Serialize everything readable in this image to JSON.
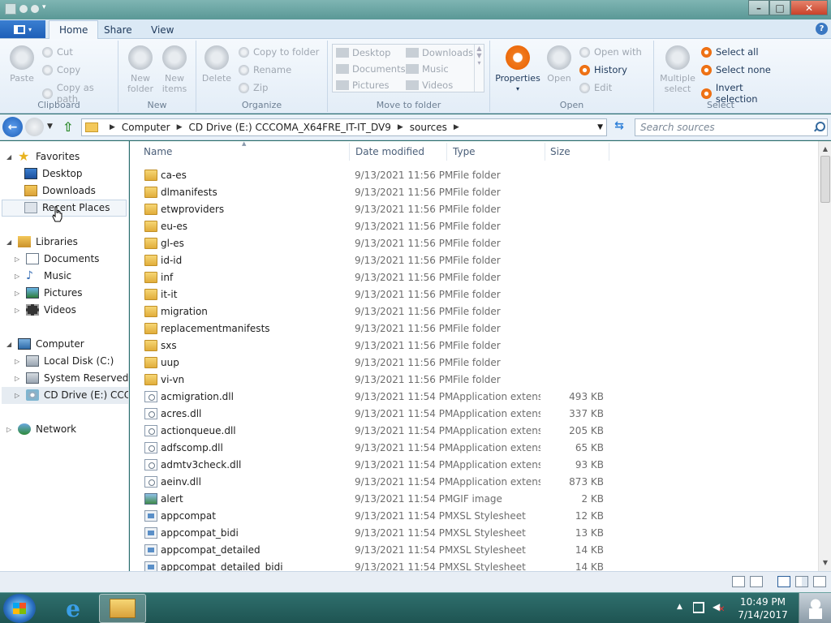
{
  "ribbon_tabs": [
    "Home",
    "Share",
    "View"
  ],
  "clipboard": {
    "paste": "Paste",
    "cut": "Cut",
    "copy": "Copy",
    "copy_as_path": "Copy as path",
    "group": "Clipboard"
  },
  "new_group": {
    "new_folder": "New folder",
    "new_items": "New items",
    "group": "New"
  },
  "organize": {
    "delete": "Delete",
    "copy_to_folder": "Copy to folder",
    "rename": "Rename",
    "zip": "Zip",
    "group": "Organize"
  },
  "move_to": {
    "items": [
      "Desktop",
      "Downloads",
      "Documents",
      "Music",
      "Pictures",
      "Videos"
    ],
    "group": "Move to folder"
  },
  "open_group": {
    "properties": "Properties",
    "open": "Open",
    "open_with": "Open with",
    "history": "History",
    "edit": "Edit",
    "group": "Open"
  },
  "select_group": {
    "multiple_select": "Multiple select",
    "select_all": "Select all",
    "select_none": "Select none",
    "invert_selection": "Invert selection",
    "group": "Select"
  },
  "breadcrumb": [
    "Computer",
    "CD Drive (E:) CCCOMA_X64FRE_IT-IT_DV9",
    "sources"
  ],
  "search": {
    "placeholder": "Search sources"
  },
  "nav": {
    "favorites": "Favorites",
    "desktop": "Desktop",
    "downloads": "Downloads",
    "recent_places": "Recent Places",
    "libraries": "Libraries",
    "documents": "Documents",
    "music": "Music",
    "pictures": "Pictures",
    "videos": "Videos",
    "computer": "Computer",
    "local_disk": "Local Disk (C:)",
    "system_reserved": "System Reserved (D:",
    "cd_drive": "CD Drive (E:) CCCOM",
    "network": "Network"
  },
  "columns": [
    "Name",
    "Date modified",
    "Type",
    "Size"
  ],
  "files": [
    {
      "name": "ca-es",
      "date": "9/13/2021 11:56 PM",
      "type": "File folder",
      "size": "",
      "icon": "folder"
    },
    {
      "name": "dlmanifests",
      "date": "9/13/2021 11:56 PM",
      "type": "File folder",
      "size": "",
      "icon": "folder"
    },
    {
      "name": "etwproviders",
      "date": "9/13/2021 11:56 PM",
      "type": "File folder",
      "size": "",
      "icon": "folder"
    },
    {
      "name": "eu-es",
      "date": "9/13/2021 11:56 PM",
      "type": "File folder",
      "size": "",
      "icon": "folder"
    },
    {
      "name": "gl-es",
      "date": "9/13/2021 11:56 PM",
      "type": "File folder",
      "size": "",
      "icon": "folder"
    },
    {
      "name": "id-id",
      "date": "9/13/2021 11:56 PM",
      "type": "File folder",
      "size": "",
      "icon": "folder"
    },
    {
      "name": "inf",
      "date": "9/13/2021 11:56 PM",
      "type": "File folder",
      "size": "",
      "icon": "folder"
    },
    {
      "name": "it-it",
      "date": "9/13/2021 11:56 PM",
      "type": "File folder",
      "size": "",
      "icon": "folder"
    },
    {
      "name": "migration",
      "date": "9/13/2021 11:56 PM",
      "type": "File folder",
      "size": "",
      "icon": "folder"
    },
    {
      "name": "replacementmanifests",
      "date": "9/13/2021 11:56 PM",
      "type": "File folder",
      "size": "",
      "icon": "folder"
    },
    {
      "name": "sxs",
      "date": "9/13/2021 11:56 PM",
      "type": "File folder",
      "size": "",
      "icon": "folder"
    },
    {
      "name": "uup",
      "date": "9/13/2021 11:56 PM",
      "type": "File folder",
      "size": "",
      "icon": "folder"
    },
    {
      "name": "vi-vn",
      "date": "9/13/2021 11:56 PM",
      "type": "File folder",
      "size": "",
      "icon": "folder"
    },
    {
      "name": "acmigration.dll",
      "date": "9/13/2021 11:54 PM",
      "type": "Application extens...",
      "size": "493 KB",
      "icon": "dll"
    },
    {
      "name": "acres.dll",
      "date": "9/13/2021 11:54 PM",
      "type": "Application extens...",
      "size": "337 KB",
      "icon": "dll"
    },
    {
      "name": "actionqueue.dll",
      "date": "9/13/2021 11:54 PM",
      "type": "Application extens...",
      "size": "205 KB",
      "icon": "dll"
    },
    {
      "name": "adfscomp.dll",
      "date": "9/13/2021 11:54 PM",
      "type": "Application extens...",
      "size": "65 KB",
      "icon": "dll"
    },
    {
      "name": "admtv3check.dll",
      "date": "9/13/2021 11:54 PM",
      "type": "Application extens...",
      "size": "93 KB",
      "icon": "dll"
    },
    {
      "name": "aeinv.dll",
      "date": "9/13/2021 11:54 PM",
      "type": "Application extens...",
      "size": "873 KB",
      "icon": "dll"
    },
    {
      "name": "alert",
      "date": "9/13/2021 11:54 PM",
      "type": "GIF image",
      "size": "2 KB",
      "icon": "gif"
    },
    {
      "name": "appcompat",
      "date": "9/13/2021 11:54 PM",
      "type": "XSL Stylesheet",
      "size": "12 KB",
      "icon": "xsl"
    },
    {
      "name": "appcompat_bidi",
      "date": "9/13/2021 11:54 PM",
      "type": "XSL Stylesheet",
      "size": "13 KB",
      "icon": "xsl"
    },
    {
      "name": "appcompat_detailed",
      "date": "9/13/2021 11:54 PM",
      "type": "XSL Stylesheet",
      "size": "14 KB",
      "icon": "xsl"
    },
    {
      "name": "appcompat_detailed_bidi",
      "date": "9/13/2021 11:54 PM",
      "type": "XSL Stylesheet",
      "size": "14 KB",
      "icon": "xsl"
    }
  ],
  "taskbar": {
    "time": "10:49 PM",
    "date": "7/14/2017"
  },
  "colors": {
    "accent": "#ec6a0c",
    "file_button": "#1d5fb8",
    "taskbar": "#1e5452"
  }
}
